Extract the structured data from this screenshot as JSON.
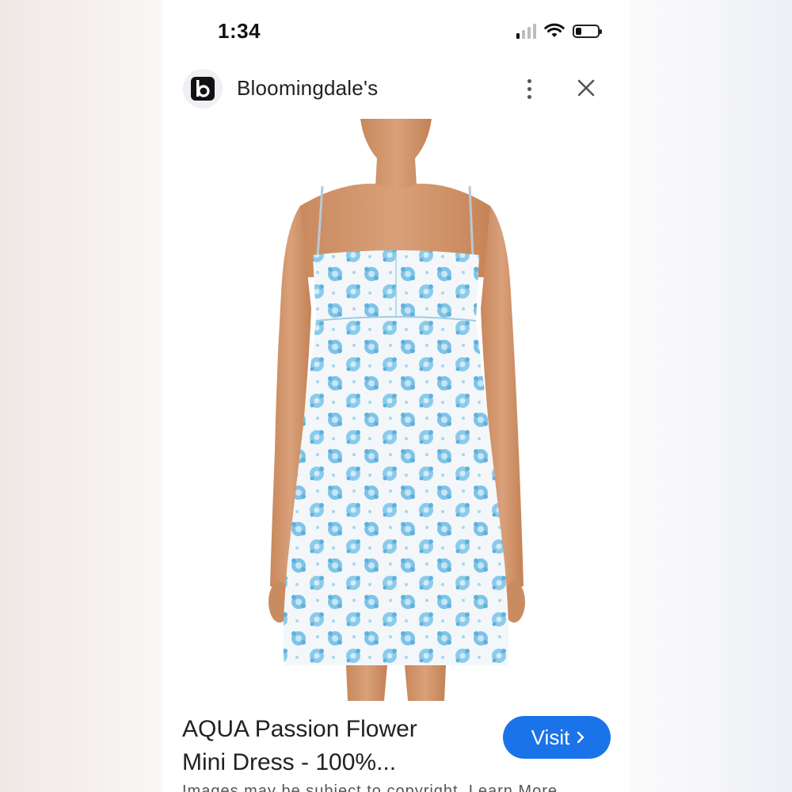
{
  "status_bar": {
    "time": "1:34",
    "signal_icon": "cellular-signal-icon",
    "wifi_icon": "wifi-icon",
    "battery_icon": "battery-low-icon"
  },
  "header": {
    "logo_icon": "bloomingdales-b-logo-icon",
    "site_name": "Bloomingdale's",
    "more_icon": "more-vertical-icon",
    "close_icon": "close-icon"
  },
  "product": {
    "image": "model-wearing-blue-floral-slip-mini-dress",
    "title_line1": "AQUA Passion Flower",
    "title_line2": "Mini Dress - 100%...",
    "visit_label": "Visit",
    "visit_icon": "chevron-right-icon",
    "subtext": "Images may be subject to copyright. Learn More"
  },
  "colors": {
    "accent": "#1a73e8",
    "text": "#222222",
    "dress_blue": "#7ec3e8"
  }
}
